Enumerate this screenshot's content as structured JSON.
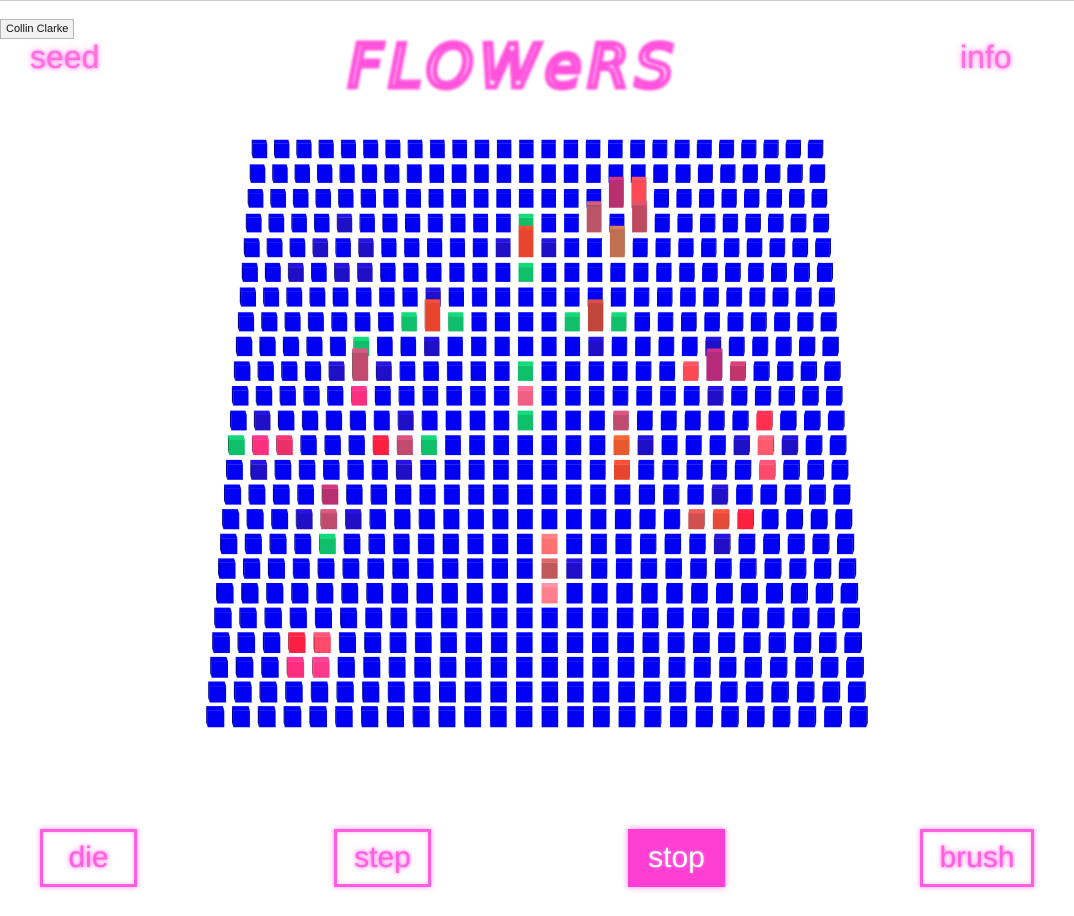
{
  "tooltip": {
    "text": "Collin Clarke"
  },
  "header": {
    "seed_label": "seed",
    "title": "FLOWeRS",
    "info_label": "info"
  },
  "grid": {
    "cols": 26,
    "rows": 24,
    "base_color": "#0000f2",
    "flowers": [
      {
        "c": 3,
        "r": 4,
        "h": 1,
        "color": "#1f10c8"
      },
      {
        "c": 4,
        "r": 3,
        "h": 1,
        "color": "#1f10c8"
      },
      {
        "c": 4,
        "r": 5,
        "h": 1,
        "color": "#1f10c8"
      },
      {
        "c": 5,
        "r": 4,
        "h": 1,
        "color": "#1f10c8"
      },
      {
        "c": 5,
        "r": 5,
        "h": 1,
        "color": "#1f10c8"
      },
      {
        "c": 2,
        "r": 5,
        "h": 1,
        "color": "#1f10c8"
      },
      {
        "c": 11,
        "r": 4,
        "h": 1,
        "color": "#1f10c8"
      },
      {
        "c": 12,
        "r": 3,
        "h": 1,
        "color": "#0fbf6a"
      },
      {
        "c": 12,
        "r": 4,
        "h": 2,
        "color": "#e8452e"
      },
      {
        "c": 12,
        "r": 5,
        "h": 1,
        "color": "#0fbf6a"
      },
      {
        "c": 13,
        "r": 4,
        "h": 1,
        "color": "#1f10c8"
      },
      {
        "c": 16,
        "r": 2,
        "h": 2,
        "color": "#b8306f"
      },
      {
        "c": 17,
        "r": 2,
        "h": 2,
        "color": "#ff4a55"
      },
      {
        "c": 15,
        "r": 3,
        "h": 2,
        "color": "#b85566"
      },
      {
        "c": 17,
        "r": 3,
        "h": 2,
        "color": "#c04a60"
      },
      {
        "c": 16,
        "r": 4,
        "h": 2,
        "color": "#c07050"
      },
      {
        "c": 8,
        "r": 6,
        "h": 1,
        "color": "#1f10c8"
      },
      {
        "c": 7,
        "r": 7,
        "h": 1,
        "color": "#0fbf6a"
      },
      {
        "c": 8,
        "r": 7,
        "h": 2,
        "color": "#e8452e"
      },
      {
        "c": 9,
        "r": 7,
        "h": 1,
        "color": "#0fbf6a"
      },
      {
        "c": 8,
        "r": 8,
        "h": 1,
        "color": "#1f10c8"
      },
      {
        "c": 14,
        "r": 7,
        "h": 1,
        "color": "#0fbf6a"
      },
      {
        "c": 15,
        "r": 7,
        "h": 2,
        "color": "#c0453a"
      },
      {
        "c": 16,
        "r": 7,
        "h": 1,
        "color": "#0fbf6a"
      },
      {
        "c": 15,
        "r": 8,
        "h": 1,
        "color": "#1f10c8"
      },
      {
        "c": 5,
        "r": 8,
        "h": 1,
        "color": "#0fbf6a"
      },
      {
        "c": 4,
        "r": 9,
        "h": 1,
        "color": "#1f10c8"
      },
      {
        "c": 5,
        "r": 9,
        "h": 2,
        "color": "#c04a70"
      },
      {
        "c": 6,
        "r": 9,
        "h": 1,
        "color": "#1f10c8"
      },
      {
        "c": 5,
        "r": 10,
        "h": 1,
        "color": "#ff2f7f"
      },
      {
        "c": 12,
        "r": 9,
        "h": 1,
        "color": "#0fbf6a"
      },
      {
        "c": 12,
        "r": 10,
        "h": 1,
        "color": "#f25f84"
      },
      {
        "c": 12,
        "r": 11,
        "h": 1,
        "color": "#0fbf6a"
      },
      {
        "c": 19,
        "r": 9,
        "h": 1,
        "color": "#ff4a55"
      },
      {
        "c": 20,
        "r": 8,
        "h": 1,
        "color": "#1f10c8"
      },
      {
        "c": 20,
        "r": 9,
        "h": 2,
        "color": "#b52a7a"
      },
      {
        "c": 21,
        "r": 9,
        "h": 1,
        "color": "#c0356b"
      },
      {
        "c": 20,
        "r": 10,
        "h": 1,
        "color": "#1f10c8"
      },
      {
        "c": 1,
        "r": 11,
        "h": 1,
        "color": "#1f10c8"
      },
      {
        "c": 0,
        "r": 12,
        "h": 1,
        "color": "#0fbf6a"
      },
      {
        "c": 1,
        "r": 12,
        "h": 1,
        "color": "#ff2f7f"
      },
      {
        "c": 2,
        "r": 12,
        "h": 1,
        "color": "#e8306a"
      },
      {
        "c": 1,
        "r": 13,
        "h": 1,
        "color": "#1f10c8"
      },
      {
        "c": 7,
        "r": 11,
        "h": 1,
        "color": "#1f10c8"
      },
      {
        "c": 6,
        "r": 12,
        "h": 1,
        "color": "#ff2040"
      },
      {
        "c": 7,
        "r": 12,
        "h": 1,
        "color": "#c04a70"
      },
      {
        "c": 8,
        "r": 12,
        "h": 1,
        "color": "#0fbf6a"
      },
      {
        "c": 7,
        "r": 13,
        "h": 1,
        "color": "#1f10c8"
      },
      {
        "c": 16,
        "r": 11,
        "h": 1,
        "color": "#c04a70"
      },
      {
        "c": 16,
        "r": 12,
        "h": 1,
        "color": "#e85a2e"
      },
      {
        "c": 17,
        "r": 12,
        "h": 1,
        "color": "#1f10c8"
      },
      {
        "c": 16,
        "r": 13,
        "h": 1,
        "color": "#e8452e"
      },
      {
        "c": 22,
        "r": 11,
        "h": 1,
        "color": "#ff2f4f"
      },
      {
        "c": 21,
        "r": 12,
        "h": 1,
        "color": "#1f10c8"
      },
      {
        "c": 22,
        "r": 12,
        "h": 1,
        "color": "#ff5a70"
      },
      {
        "c": 23,
        "r": 12,
        "h": 1,
        "color": "#1f10c8"
      },
      {
        "c": 22,
        "r": 13,
        "h": 1,
        "color": "#ff4a6a"
      },
      {
        "c": 4,
        "r": 14,
        "h": 1,
        "color": "#b8306f"
      },
      {
        "c": 3,
        "r": 15,
        "h": 1,
        "color": "#1f10c8"
      },
      {
        "c": 4,
        "r": 15,
        "h": 1,
        "color": "#c04a70"
      },
      {
        "c": 5,
        "r": 15,
        "h": 1,
        "color": "#1f10c8"
      },
      {
        "c": 4,
        "r": 16,
        "h": 1,
        "color": "#0fbf6a"
      },
      {
        "c": 20,
        "r": 14,
        "h": 1,
        "color": "#1f10c8"
      },
      {
        "c": 19,
        "r": 15,
        "h": 1,
        "color": "#d0504f"
      },
      {
        "c": 20,
        "r": 15,
        "h": 1,
        "color": "#e84a3a"
      },
      {
        "c": 21,
        "r": 15,
        "h": 1,
        "color": "#ff2040"
      },
      {
        "c": 20,
        "r": 16,
        "h": 1,
        "color": "#1f10c8"
      },
      {
        "c": 13,
        "r": 16,
        "h": 1,
        "color": "#ff7070"
      },
      {
        "c": 13,
        "r": 17,
        "h": 1,
        "color": "#c05a5a"
      },
      {
        "c": 14,
        "r": 17,
        "h": 1,
        "color": "#1f10c8"
      },
      {
        "c": 13,
        "r": 18,
        "h": 1,
        "color": "#ff7f8f"
      },
      {
        "c": 3,
        "r": 20,
        "h": 1,
        "color": "#ff1f40"
      },
      {
        "c": 4,
        "r": 20,
        "h": 1,
        "color": "#ff4a6a"
      },
      {
        "c": 3,
        "r": 21,
        "h": 1,
        "color": "#ff2f7f"
      },
      {
        "c": 4,
        "r": 21,
        "h": 1,
        "color": "#ff3a8a"
      }
    ]
  },
  "controls": {
    "die": "die",
    "step": "step",
    "stop": "stop",
    "brush": "brush"
  }
}
